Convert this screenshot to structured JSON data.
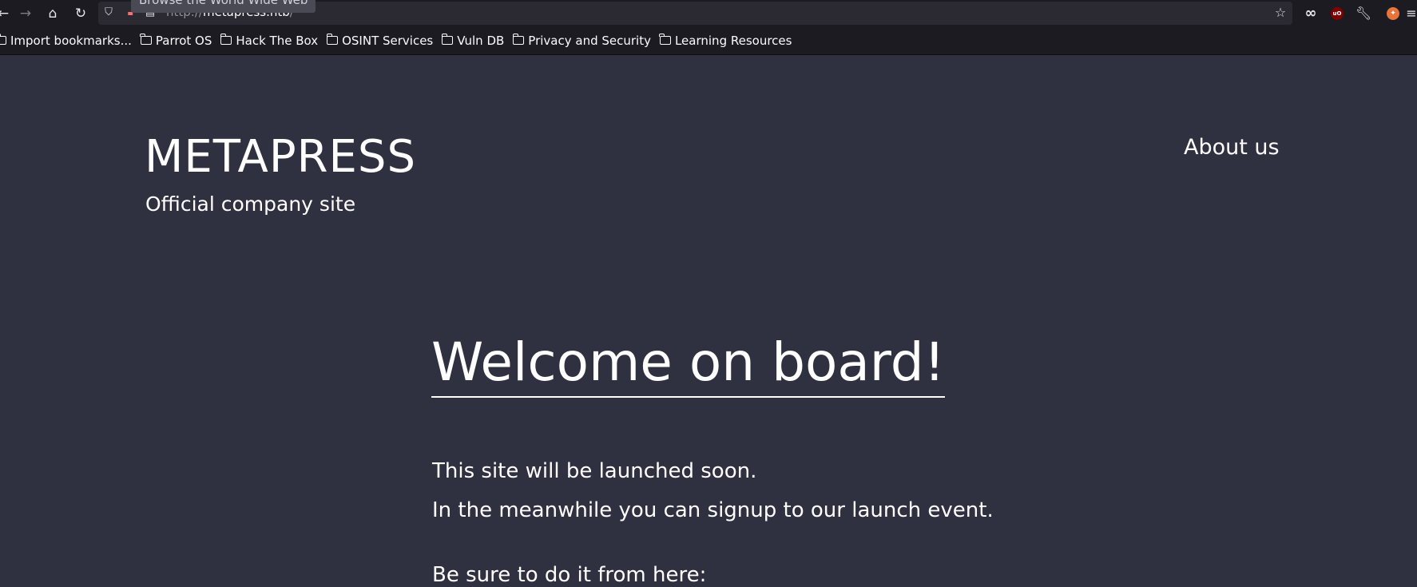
{
  "browser": {
    "url_scheme": "http://",
    "url_host": "metapress.htb",
    "url_path": "/",
    "tooltip": "Browse the World Wide Web",
    "bookmarks": [
      {
        "label": "Import bookmarks..."
      },
      {
        "label": "Parrot OS"
      },
      {
        "label": "Hack The Box"
      },
      {
        "label": "OSINT Services"
      },
      {
        "label": "Vuln DB"
      },
      {
        "label": "Privacy and Security"
      },
      {
        "label": "Learning Resources"
      }
    ],
    "icons": [
      "back-icon",
      "forward-icon",
      "home-icon",
      "reload-icon",
      "shield-icon",
      "lock-icon",
      "page-icon",
      "star-icon",
      "infinity-icon",
      "ublock-icon",
      "wrench-icon",
      "foxyproxy-icon",
      "menu-icon"
    ],
    "extensions": {
      "ublock_badge": "uO"
    }
  },
  "site": {
    "title": "METAPRESS",
    "tagline": "Official company site",
    "nav_about": "About us"
  },
  "main": {
    "heading": "Welcome on board!",
    "line1": "This site will be launched soon.",
    "line2": "In the meanwhile you can signup to our launch event.",
    "line3": "Be sure to do it from here:"
  },
  "colors": {
    "page_bg": "#2f3141",
    "chrome_bg": "#1c1b22",
    "urlbar_bg": "#2b2a33",
    "text": "#ffffff"
  }
}
